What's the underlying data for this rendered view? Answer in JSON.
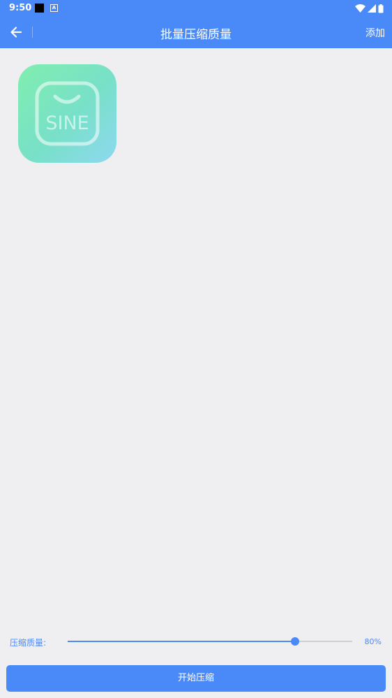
{
  "status": {
    "time": "9:50"
  },
  "header": {
    "title": "批量压缩质量",
    "add_label": "添加"
  },
  "images": [
    {
      "logo_text": "SINE"
    }
  ],
  "quality": {
    "label": "压缩质量:",
    "value": 80,
    "value_text": "80%"
  },
  "footer": {
    "start_label": "开始压缩"
  },
  "colors": {
    "accent": "#4a8af8",
    "background": "#efeff2"
  }
}
